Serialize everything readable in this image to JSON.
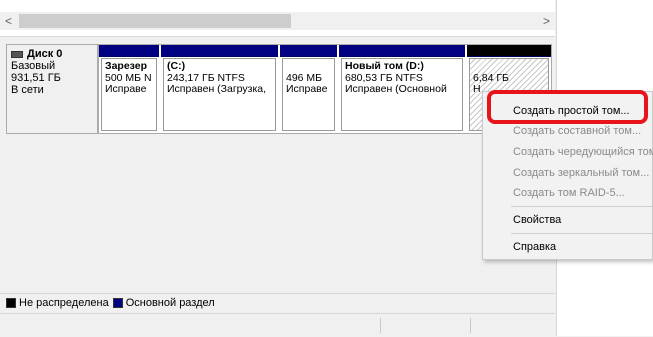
{
  "disk": {
    "name": "Диск 0",
    "type": "Базовый",
    "size": "931,51 ГБ",
    "status": "В сети"
  },
  "partitions": [
    {
      "name": "Зарезер",
      "size": "500 МБ N",
      "status": "Исправе"
    },
    {
      "name": "(C:)",
      "size": "243,17 ГБ NTFS",
      "status": "Исправен (Загрузка,"
    },
    {
      "name": "",
      "size": "496 МБ",
      "status": "Исправе"
    },
    {
      "name": "Новый том  (D:)",
      "size": "680,53 ГБ NTFS",
      "status": "Исправен (Основной"
    },
    {
      "name": "",
      "size": "6,84 ГБ",
      "status": "Н"
    }
  ],
  "legend": {
    "unallocated": "Не распределена",
    "primary": "Основной раздел"
  },
  "colors": {
    "primary_partition": "#000080",
    "unallocated": "#000000",
    "highlight": "#e8141b"
  },
  "context_menu": {
    "items": [
      {
        "label": "Создать простой том...",
        "enabled": true
      },
      {
        "label": "Создать составной том...",
        "enabled": false
      },
      {
        "label": "Создать чередующийся том",
        "enabled": false
      },
      {
        "label": "Создать зеркальный том...",
        "enabled": false
      },
      {
        "label": "Создать том RAID-5...",
        "enabled": false
      },
      {
        "label": "Свойства",
        "enabled": true
      },
      {
        "label": "Справка",
        "enabled": true
      }
    ]
  },
  "scrollbar": {
    "left_arrow": "<",
    "right_arrow": ">"
  }
}
